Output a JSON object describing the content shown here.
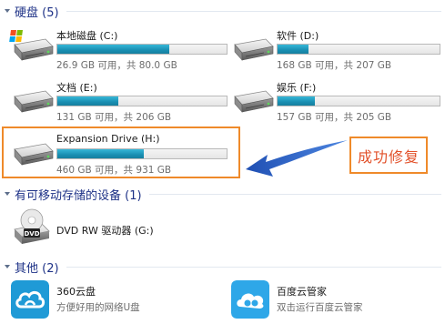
{
  "sections": {
    "hard_disks": "硬盘 (5)",
    "removable": "有可移动存储的设备 (1)",
    "other": "其他 (2)"
  },
  "drives": [
    {
      "name": "本地磁盘 (C:)",
      "stat": "26.9 GB 可用，共 80.0 GB",
      "used_fraction": 0.66,
      "icon": "windows-system-drive-icon"
    },
    {
      "name": "软件 (D:)",
      "stat": "168 GB 可用，共 207 GB",
      "used_fraction": 0.19,
      "icon": "hard-drive-icon"
    },
    {
      "name": "文档 (E:)",
      "stat": "131 GB 可用，共 206 GB",
      "used_fraction": 0.36,
      "icon": "hard-drive-icon"
    },
    {
      "name": "娱乐 (F:)",
      "stat": "157 GB 可用，共 205 GB",
      "used_fraction": 0.23,
      "icon": "hard-drive-icon"
    },
    {
      "name": "Expansion Drive (H:)",
      "stat": "460 GB 可用，共 931 GB",
      "used_fraction": 0.51,
      "icon": "hard-drive-icon"
    }
  ],
  "removable_devices": [
    {
      "name": "DVD RW 驱动器 (G:)",
      "icon": "dvd-drive-icon"
    }
  ],
  "other_items": [
    {
      "name": "360云盘",
      "desc": "方便好用的网络U盘",
      "icon": "360-cloud-icon"
    },
    {
      "name": "百度云管家",
      "desc": "双击运行百度云管家",
      "icon": "baidu-cloud-icon"
    }
  ],
  "annotation": {
    "callout_text": "成功修复",
    "accent": "#ef8a2a",
    "text_color": "#e2512a"
  },
  "colors": {
    "header_text": "#1e3287",
    "bar_fill": "#1a8fb2"
  }
}
